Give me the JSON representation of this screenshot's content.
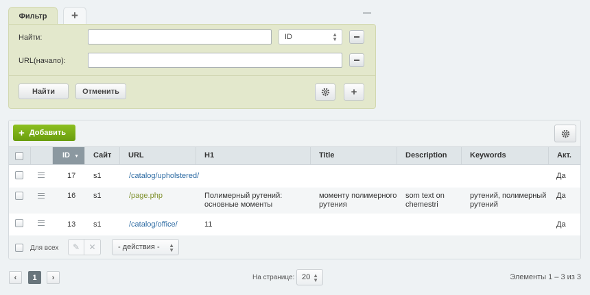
{
  "filter": {
    "tab_label": "Фильтр",
    "add_tab_label": "+",
    "find_label": "Найти:",
    "find_value": "",
    "find_field_select": "ID",
    "url_label": "URL(начало):",
    "url_value": "",
    "find_button": "Найти",
    "cancel_button": "Отменить",
    "add_label": "+"
  },
  "grid": {
    "add_button": "Добавить",
    "columns": [
      "ID",
      "Сайт",
      "URL",
      "H1",
      "Title",
      "Description",
      "Keywords",
      "Акт."
    ],
    "sorted_column": "ID",
    "rows": [
      {
        "id": "17",
        "site": "s1",
        "url": "/catalog/upholstered/",
        "h1": "",
        "title": "",
        "description": "",
        "keywords": "",
        "active": "Да"
      },
      {
        "id": "16",
        "site": "s1",
        "url": "/page.php",
        "h1": "Полимерный рутений: основные моменты",
        "title": "моменту полимерного рутения",
        "description": "som text on chemestri",
        "keywords": "рутений, полимерный рутений",
        "active": "Да"
      },
      {
        "id": "13",
        "site": "s1",
        "url": "/catalog/office/",
        "h1": "11",
        "title": "",
        "description": "",
        "keywords": "",
        "active": "Да"
      }
    ],
    "select_all_label": "Для всех",
    "actions_select": "- действия -"
  },
  "pagination": {
    "prev": "‹",
    "current_page": "1",
    "next": "›",
    "per_page_label": "На странице:",
    "per_page_value": "20",
    "total_text": "Элементы 1 – 3 из 3"
  },
  "colors": {
    "accent_green": "#7aae16",
    "filter_bg": "#e3e8cc",
    "sorted_header": "#8b98a0",
    "link": "#2d6ba3"
  },
  "icons": [
    "plus-icon",
    "minus-icon",
    "gear-icon",
    "menu-icon",
    "pencil-icon",
    "close-icon",
    "chevron-left-icon",
    "chevron-right-icon"
  ]
}
